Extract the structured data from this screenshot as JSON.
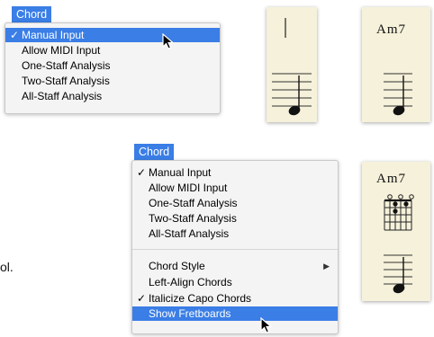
{
  "top_menu": {
    "title": "Chord",
    "items": [
      {
        "label": "Manual Input",
        "checked": true,
        "highlighted": true
      },
      {
        "label": "Allow MIDI Input",
        "checked": false
      },
      {
        "label": "One-Staff Analysis",
        "checked": false
      },
      {
        "label": "Two-Staff Analysis",
        "checked": false
      },
      {
        "label": "All-Staff Analysis",
        "checked": false
      }
    ]
  },
  "bottom_menu": {
    "title": "Chord",
    "items": [
      {
        "label": "Manual Input",
        "checked": true
      },
      {
        "label": "Allow MIDI Input",
        "checked": false
      },
      {
        "label": "One-Staff Analysis",
        "checked": false
      },
      {
        "label": "Two-Staff Analysis",
        "checked": false
      },
      {
        "label": "All-Staff Analysis",
        "checked": false
      }
    ],
    "items2": [
      {
        "label": "Chord Style",
        "submenu": true
      },
      {
        "label": "Left-Align Chords",
        "checked": false
      },
      {
        "label": "Italicize Capo Chords",
        "checked": true
      },
      {
        "label": "Show Fretboards",
        "highlighted": true
      }
    ]
  },
  "check_glyph": "✓",
  "submenu_glyph": "▶",
  "chord_symbol": "Am7",
  "side_text": "ol.",
  "colors": {
    "accent": "#3a7ee6",
    "paper": "#f5f1da"
  }
}
